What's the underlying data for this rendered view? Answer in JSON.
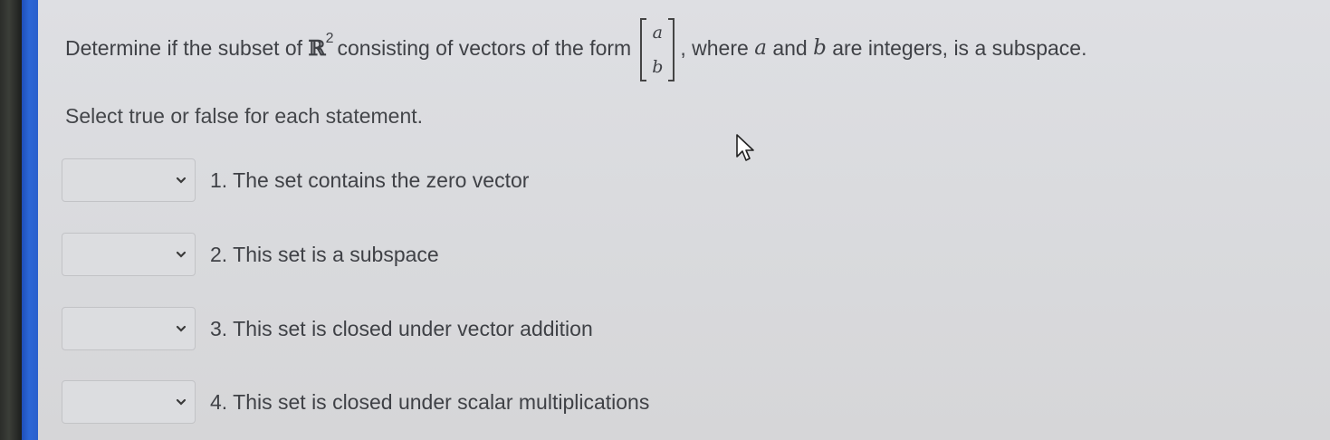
{
  "question": {
    "before_space": "Determine if the subset of",
    "space_symbol": "ℝ",
    "exponent": "2",
    "middle": "consisting of vectors of the form",
    "vector_top": "a",
    "vector_bottom": "b",
    "after_where": ", where",
    "var_a": "a",
    "and_word": "and",
    "var_b": "b",
    "ending": "are integers, is a subspace."
  },
  "instruction": "Select true or false for each statement.",
  "statements": [
    {
      "label": "1. The set contains the zero vector",
      "selected": ""
    },
    {
      "label": "2. This set is a subspace",
      "selected": ""
    },
    {
      "label": "3. This set is closed under vector addition",
      "selected": ""
    },
    {
      "label": "4. This set is closed under scalar multiplications",
      "selected": ""
    }
  ],
  "icons": {
    "dropdown": "chevron-down-icon",
    "pointer": "mouse-pointer-icon"
  },
  "colors": {
    "background": "#d9dadd",
    "text": "#3f4146",
    "left_edge_blue": "#2a5fcc"
  }
}
